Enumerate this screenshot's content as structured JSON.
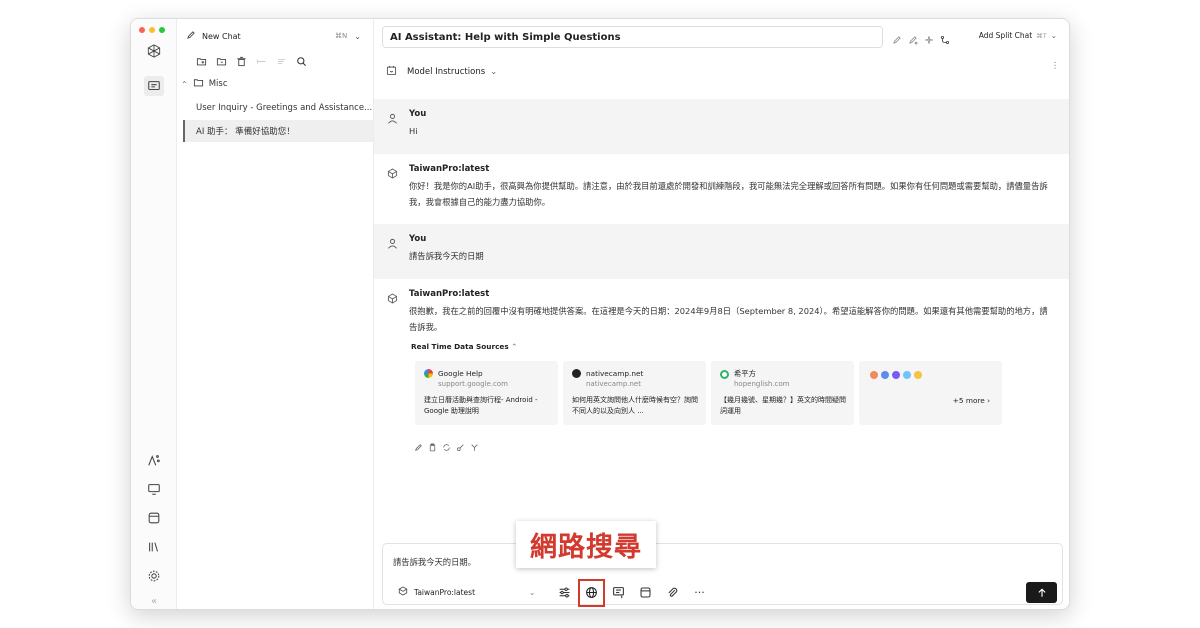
{
  "colors": {
    "traffic_red": "#ff5f57",
    "traffic_yellow": "#febc2e",
    "traffic_green": "#28c840",
    "highlight": "#d23a2e",
    "send_bg": "#1a1a1a"
  },
  "sidebar": {
    "new_chat_label": "New Chat",
    "new_chat_shortcut": "⌘N",
    "folder_name": "Misc",
    "chats": [
      {
        "title": "User Inquiry - Greetings and Assistance...",
        "active": false
      },
      {
        "title": "AI 助手： 準備好協助您！",
        "active": true
      }
    ]
  },
  "header": {
    "chat_title": "AI Assistant: Help with Simple Questions",
    "split_label": "Add Split Chat",
    "split_shortcut": "⌘T",
    "model_instructions": "Model Instructions"
  },
  "messages": [
    {
      "role": "user",
      "author": "You",
      "text": "Hi"
    },
    {
      "role": "assistant",
      "author": "TaiwanPro:latest",
      "text": "你好！我是你的AI助手，很高興為你提供幫助。請注意，由於我目前還處於開發和訓練階段，我可能無法完全理解或回答所有問題。如果你有任何問題或需要幫助，請儘量告訴我，我會根據自己的能力盡力協助你。"
    },
    {
      "role": "user",
      "author": "You",
      "text": "請告訴我今天的日期"
    },
    {
      "role": "assistant",
      "author": "TaiwanPro:latest",
      "text": "很抱歉，我在之前的回覆中沒有明確地提供答案。在這裡是今天的日期：2024年9月8日（September 8, 2024）。希望這能解答你的問題。如果還有其他需要幫助的地方，請告訴我。"
    }
  ],
  "sources": {
    "label": "Real Time Data Sources",
    "cards": [
      {
        "site": "Google Help",
        "domain": "support.google.com",
        "snippet": "建立日曆活動與查詢行程- Android - Google 助理說明",
        "favicon": "google-icon"
      },
      {
        "site": "nativecamp.net",
        "domain": "nativecamp.net",
        "snippet": "如何用英文詢問他人什麼時候有空？詢問不同人的以及向別人 ...",
        "favicon": "nativecamp-icon"
      },
      {
        "site": "希平方",
        "domain": "hopenglish.com",
        "snippet": "【幾月幾號、星期幾？】英文的時間疑問詞運用",
        "favicon": "hopenglish-icon"
      }
    ],
    "more_label": "+5 more ›"
  },
  "composer": {
    "input_text": "請告訴我今天的日期。",
    "model": "TaiwanPro:latest",
    "more_icon": "···"
  },
  "callout": {
    "text": "網路搜尋"
  }
}
